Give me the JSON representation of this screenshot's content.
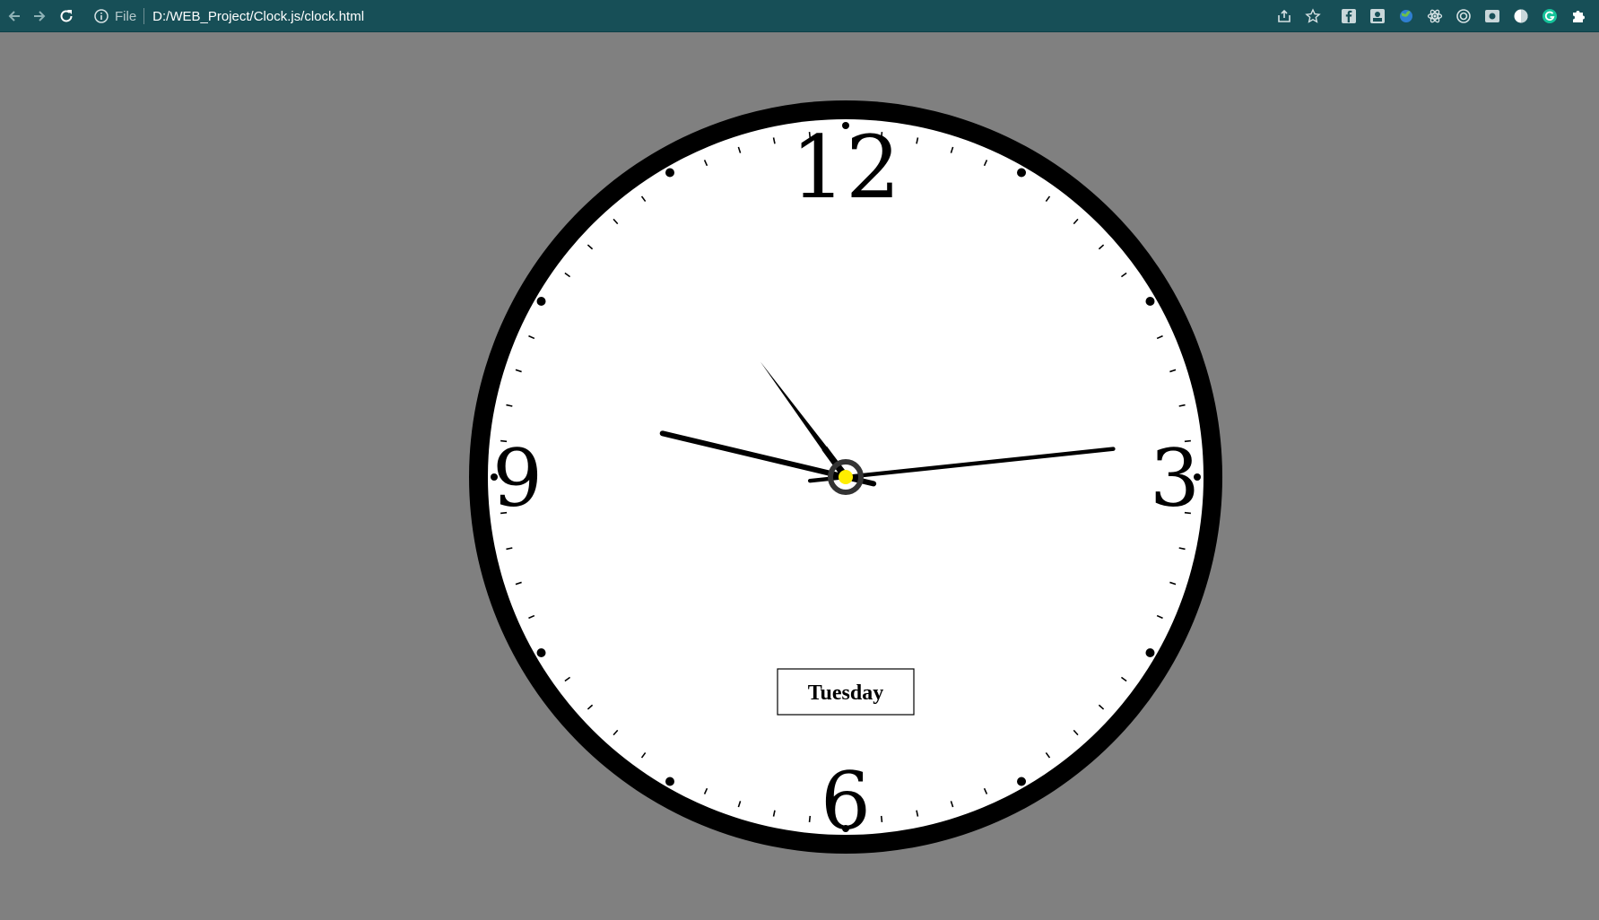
{
  "browser": {
    "scheme_label": "File",
    "url": "D:/WEB_Project/Clock.js/clock.html",
    "nav_icons": [
      "back-arrow-icon",
      "forward-arrow-icon",
      "reload-icon"
    ],
    "right_icons": [
      "share-icon",
      "bookmark-star-icon"
    ],
    "extensions": [
      "facebook-extension-icon",
      "photo-extension-icon",
      "globe-extension-icon",
      "react-devtools-extension-icon",
      "target-extension-icon",
      "screenshot-extension-icon",
      "circle-extension-icon",
      "grammarly-extension-icon",
      "extensions-puzzle-icon"
    ]
  },
  "clock": {
    "background": "#808080",
    "face_color": "#ffffff",
    "rim_color": "#000000",
    "center_dot_color": "#ffee00",
    "numerals": [
      {
        "label": "12",
        "position_hour": 12
      },
      {
        "label": "3",
        "position_hour": 3
      },
      {
        "label": "6",
        "position_hour": 6
      },
      {
        "label": "9",
        "position_hour": 9
      }
    ],
    "time": {
      "hours": 10,
      "minutes": 47,
      "seconds": 14
    },
    "day_label": "Tuesday"
  }
}
